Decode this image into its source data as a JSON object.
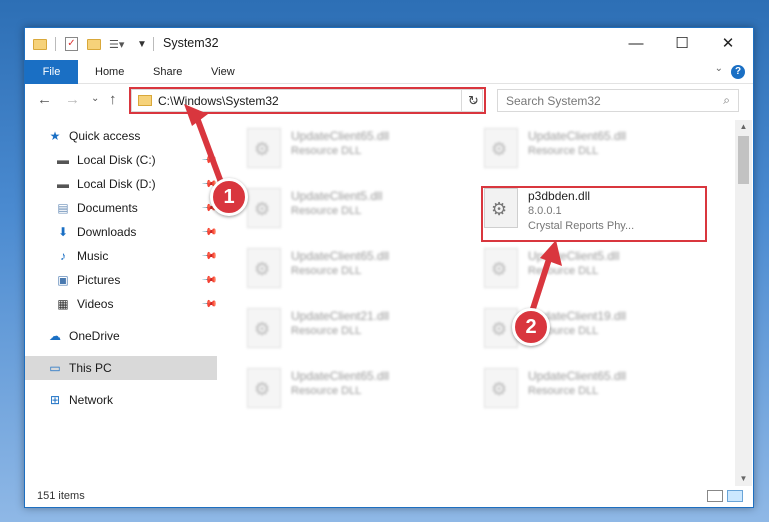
{
  "titlebar": {
    "title": "System32",
    "minimize": "—",
    "maximize": "☐",
    "close": "✕"
  },
  "ribbon": {
    "tabs": [
      "File",
      "Home",
      "Share",
      "View"
    ],
    "help": "?",
    "collapse": "⌄"
  },
  "nav": {
    "back": "←",
    "forward": "→",
    "recent": "⌄",
    "up": "↑"
  },
  "address": {
    "path": "C:\\Windows\\System32",
    "dropdown": "⌄",
    "refresh": "↻"
  },
  "search": {
    "placeholder": "Search System32",
    "icon": "search-icon"
  },
  "sidebar": {
    "items": [
      {
        "label": "Quick access",
        "icon": "star-icon",
        "pinned": false
      },
      {
        "label": "Local Disk (C:)",
        "icon": "drive-icon",
        "pinned": true
      },
      {
        "label": "Local Disk (D:)",
        "icon": "drive-icon",
        "pinned": true
      },
      {
        "label": "Documents",
        "icon": "documents-icon",
        "pinned": true
      },
      {
        "label": "Downloads",
        "icon": "downloads-icon",
        "pinned": true
      },
      {
        "label": "Music",
        "icon": "music-icon",
        "pinned": true
      },
      {
        "label": "Pictures",
        "icon": "pictures-icon",
        "pinned": true
      },
      {
        "label": "Videos",
        "icon": "videos-icon",
        "pinned": true
      },
      {
        "label": "OneDrive",
        "icon": "cloud-icon",
        "pinned": false
      },
      {
        "label": "This PC",
        "icon": "computer-icon",
        "pinned": false
      },
      {
        "label": "Network",
        "icon": "network-icon",
        "pinned": false
      }
    ]
  },
  "files": [
    {
      "name": "UpdateClient65.dll",
      "type": "Resource DLL",
      "blurred": true
    },
    {
      "name": "UpdateClient65.dll",
      "type": "Resource DLL",
      "blurred": true
    },
    {
      "name": "UpdateClient5.dll",
      "type": "Resource DLL",
      "blurred": true
    },
    {
      "name": "p3dbden.dll",
      "version": "8.0.0.1",
      "type": "Crystal Reports Phy...",
      "blurred": false
    },
    {
      "name": "UpdateClient65.dll",
      "type": "Resource DLL",
      "blurred": true
    },
    {
      "name": "UpdateClient5.dll",
      "type": "Resource DLL",
      "blurred": true
    },
    {
      "name": "UpdateClient21.dll",
      "type": "Resource DLL",
      "blurred": true
    },
    {
      "name": "UpdateClient19.dll",
      "type": "Resource DLL",
      "blurred": true
    },
    {
      "name": "UpdateClient65.dll",
      "type": "Resource DLL",
      "blurred": true
    },
    {
      "name": "UpdateClient65.dll",
      "type": "Resource DLL",
      "blurred": true
    }
  ],
  "status": {
    "count": "151 items"
  },
  "callouts": {
    "one": "1",
    "two": "2"
  },
  "colors": {
    "accent": "#1a6fc4",
    "highlight": "#d9363e",
    "selection": "#cce8ff"
  }
}
